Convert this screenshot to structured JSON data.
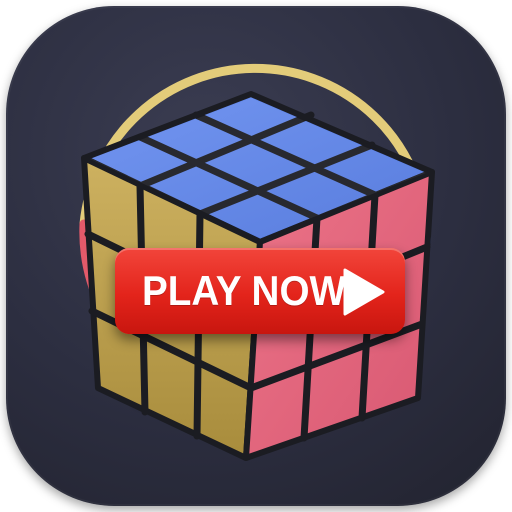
{
  "app_icon": {
    "name": "rubiks-cube-game-icon",
    "background_color": "#2c2e40",
    "ring_colors": [
      "#e3cc7a",
      "#e35a6a",
      "#5b78e6"
    ]
  },
  "cube": {
    "face_colors": {
      "top": "#5b84ea",
      "left": "#c4a64e",
      "right": "#e86880"
    }
  },
  "cta": {
    "label": "PLAY NOW",
    "button_color": "#e3241b",
    "icon": "play-triangle-icon"
  }
}
